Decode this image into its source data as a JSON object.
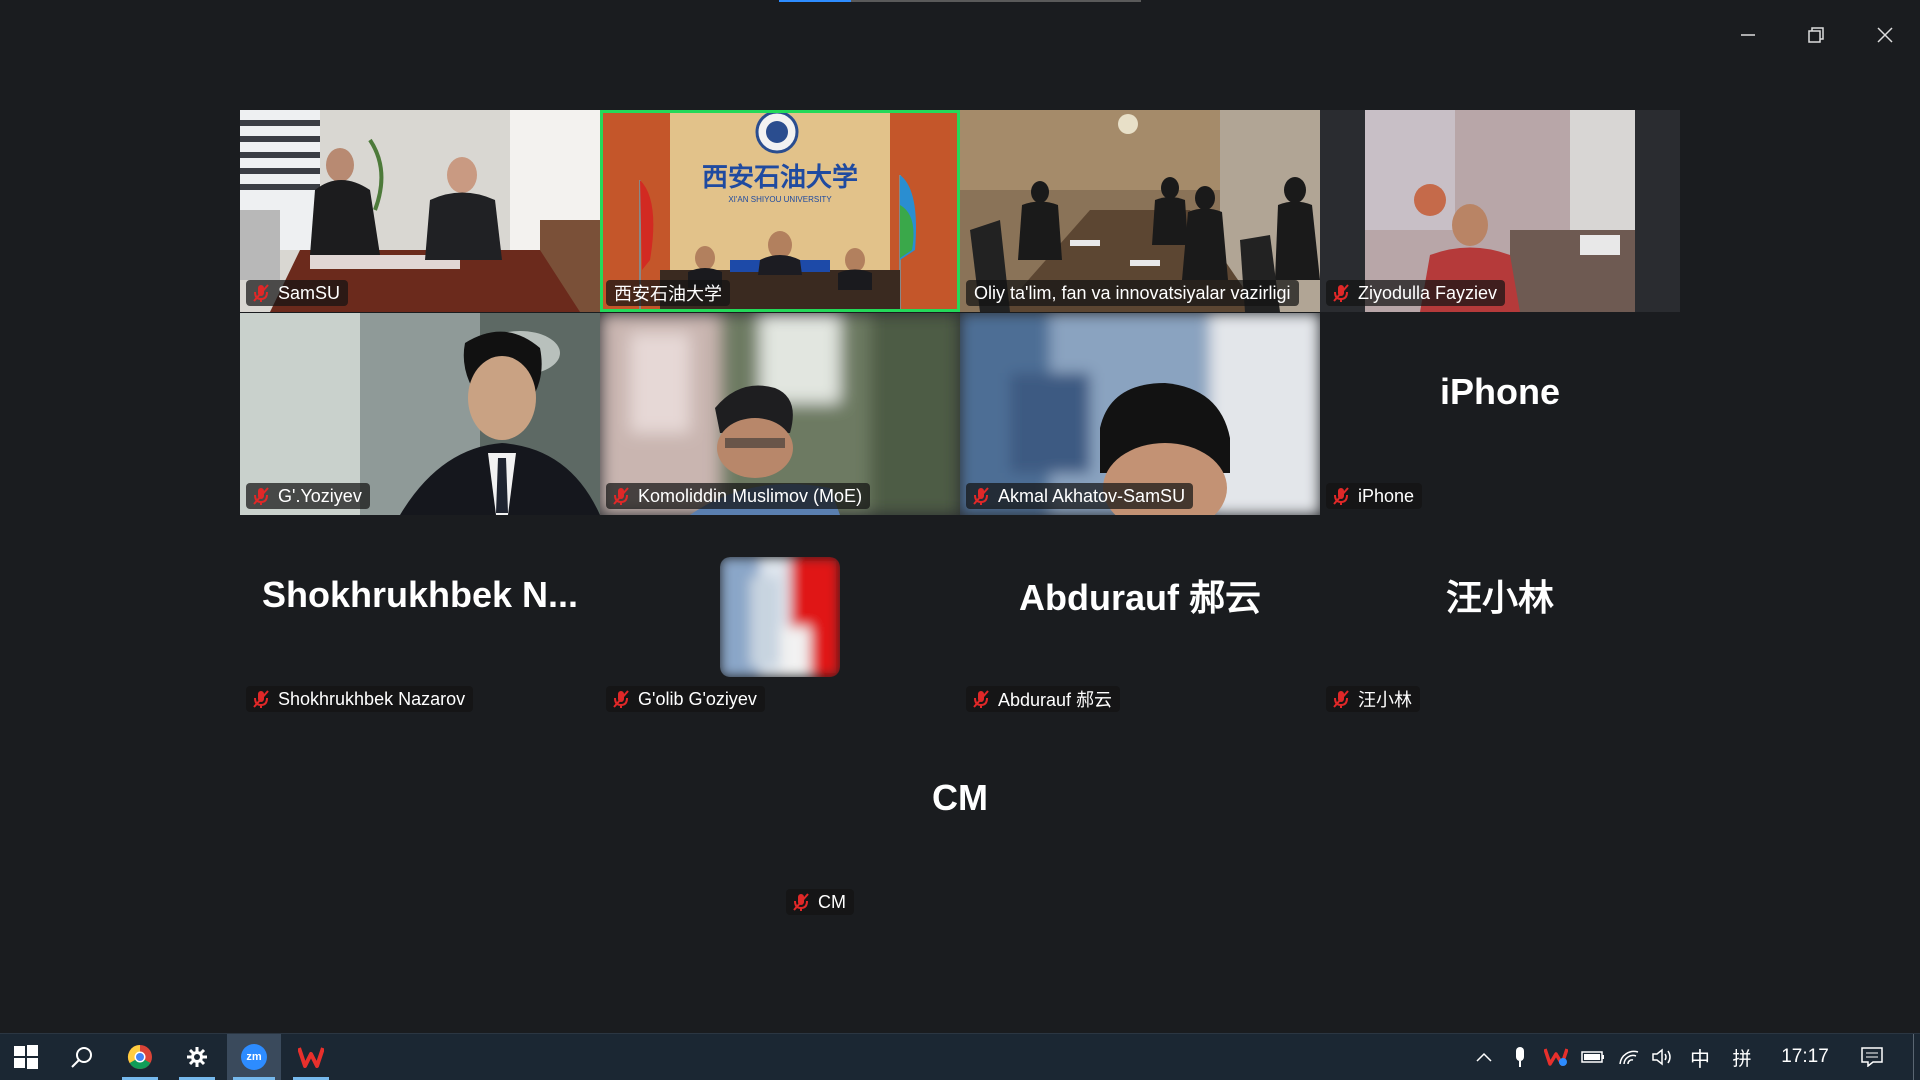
{
  "window": {
    "minimize_icon": "minimize-icon",
    "restore_icon": "restore-icon",
    "close_icon": "close-icon"
  },
  "participants": [
    {
      "name": "SamSU",
      "mic": "muted",
      "video": true,
      "scene": "office-meeting"
    },
    {
      "name": "西安石油大学",
      "mic": "none",
      "video": true,
      "scene": "university-conference",
      "active": true,
      "logo_text": "西安石油大学",
      "logo_sub": "XI'AN SHIYOU UNIVERSITY"
    },
    {
      "name": "Oliy ta'lim, fan va innovatsiyalar vazirligi",
      "mic": "none",
      "video": true,
      "scene": "ministry-boardroom"
    },
    {
      "name": "Ziyodulla Fayziev",
      "mic": "muted",
      "video": true,
      "scene": "office-desk"
    },
    {
      "name": "G'.Yoziyev",
      "mic": "muted",
      "video": true,
      "scene": "person-suit"
    },
    {
      "name": "Komoliddin Muslimov (MoE)",
      "mic": "muted",
      "video": true,
      "scene": "person-blurred"
    },
    {
      "name": "Akmal Akhatov-SamSU",
      "mic": "muted",
      "video": true,
      "scene": "person-head"
    },
    {
      "name": "iPhone",
      "mic": "muted",
      "video": false,
      "display": "iPhone"
    },
    {
      "name": "Shokhrukhbek Nazarov",
      "mic": "muted",
      "video": false,
      "display": "Shokhrukhbek  N..."
    },
    {
      "name": "G'olib G'oziyev",
      "mic": "muted",
      "video": false,
      "avatar": true
    },
    {
      "name": "Abdurauf 郝云",
      "mic": "muted",
      "video": false,
      "display": "Abdurauf 郝云"
    },
    {
      "name": "汪小林",
      "mic": "muted",
      "video": false,
      "display": "汪小林"
    },
    {
      "name": "CM",
      "mic": "muted",
      "video": false,
      "display": "CM"
    }
  ],
  "colors": {
    "background": "#1a1c1f",
    "active_speaker": "#23d959",
    "mic_muted": "#e02828",
    "taskbar": "#1b2733"
  },
  "taskbar": {
    "apps": [
      "start-icon",
      "search-icon",
      "chrome-icon",
      "settings-icon",
      "zoom-icon",
      "wps-icon"
    ],
    "zoom_label": "zm",
    "tray_icons": [
      "chevron-up-icon",
      "microphone-icon",
      "wps-tray-icon",
      "battery-icon",
      "wifi-icon",
      "volume-icon"
    ],
    "ime_lang": "中",
    "ime_mode": "拼",
    "clock": "17:17",
    "notification_icon": "notification-icon"
  }
}
